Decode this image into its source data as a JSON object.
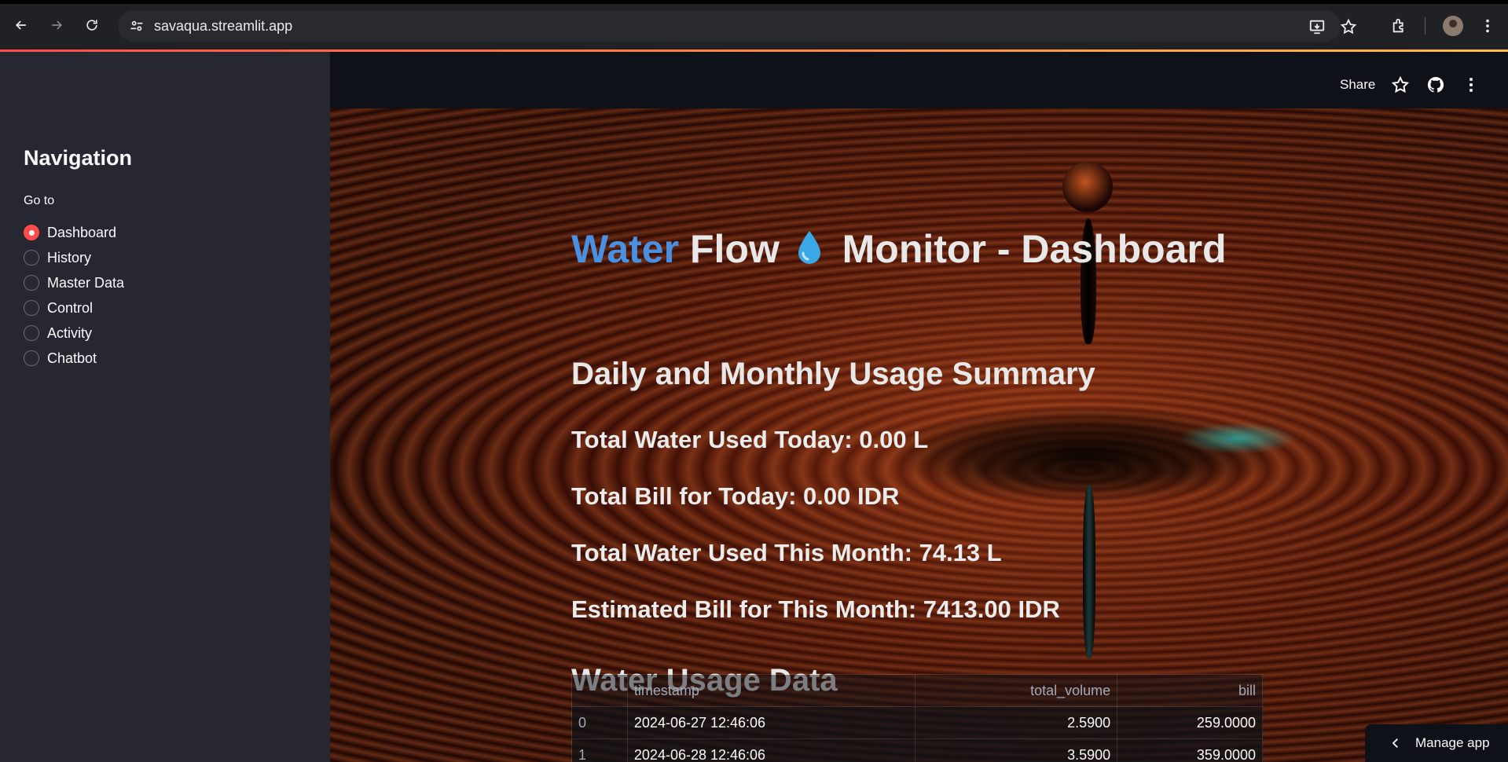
{
  "browser": {
    "url": "savaqua.streamlit.app"
  },
  "sidebar": {
    "title": "Navigation",
    "radio_label": "Go to",
    "items": [
      {
        "label": "Dashboard",
        "selected": true
      },
      {
        "label": "History",
        "selected": false
      },
      {
        "label": "Master Data",
        "selected": false
      },
      {
        "label": "Control",
        "selected": false
      },
      {
        "label": "Activity",
        "selected": false
      },
      {
        "label": "Chatbot",
        "selected": false
      }
    ]
  },
  "toolbar": {
    "share_label": "Share"
  },
  "page": {
    "title_word1": "Water",
    "title_word2": "Flow",
    "title_rest": "Monitor - Dashboard",
    "summary_heading": "Daily and Monthly Usage Summary",
    "stats": [
      "Total Water Used Today: 0.00 L",
      "Total Bill for Today: 0.00 IDR",
      "Total Water Used This Month: 74.13 L",
      "Estimated Bill for This Month: 7413.00 IDR"
    ],
    "table_heading": "Water Usage Data",
    "table": {
      "columns": [
        "",
        "timestamp",
        "total_volume",
        "bill"
      ],
      "rows": [
        [
          "0",
          "2024-06-27 12:46:06",
          "2.5900",
          "259.0000"
        ],
        [
          "1",
          "2024-06-28 12:46:06",
          "3.5900",
          "359.0000"
        ]
      ]
    }
  },
  "manage_app": {
    "label": "Manage app"
  },
  "colors": {
    "accent": "#ff4b4b",
    "title_accent": "#4a90e2",
    "sidebar_bg": "#262730",
    "app_bg": "#0e1117"
  }
}
